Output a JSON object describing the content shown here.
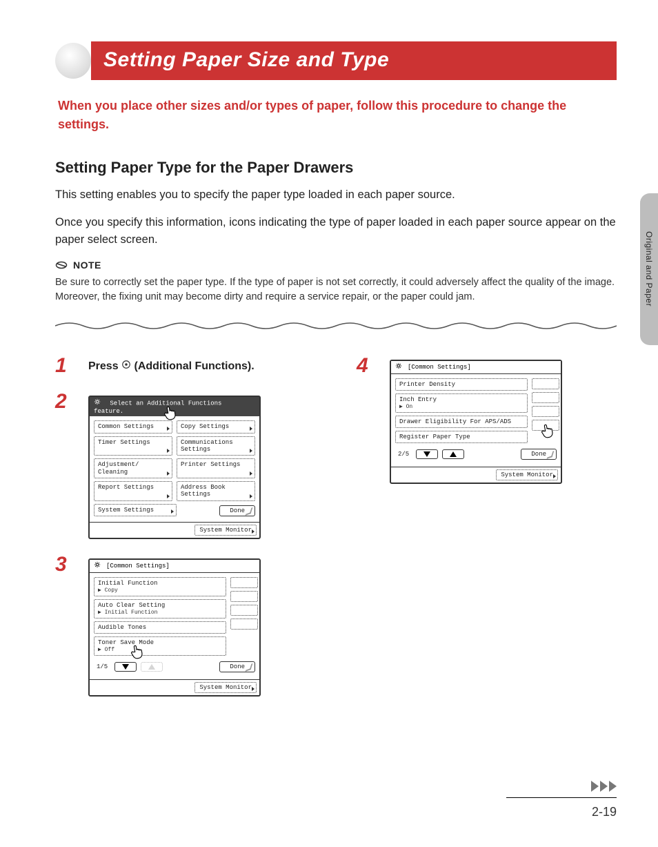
{
  "side_tab": "Original and Paper",
  "title": "Setting Paper Size and Type",
  "intro": "When you place other sizes and/or types of paper, follow this procedure to change the settings.",
  "section_heading": "Setting Paper Type for the Paper Drawers",
  "section_body_1": "This setting enables you to specify the paper type loaded in each paper source.",
  "section_body_2": "Once you specify this information, icons indicating the type of paper loaded in each paper source appear on the paper select screen.",
  "note_label": "NOTE",
  "note_body": "Be sure to correctly set the paper type. If the type of paper is not set correctly, it could adversely affect the quality of the image. Moreover, the fixing unit may become dirty and require a service repair, or the paper could jam.",
  "steps": {
    "s1": {
      "num": "1",
      "label_pre": "Press ",
      "label_post": " (Additional Functions)."
    },
    "s2": {
      "num": "2"
    },
    "s3": {
      "num": "3"
    },
    "s4": {
      "num": "4"
    }
  },
  "screen2": {
    "title": "Select an Additional Functions feature.",
    "buttons": [
      [
        "Common Settings",
        "Copy Settings"
      ],
      [
        "Timer Settings",
        "Communications Settings"
      ],
      [
        "Adjustment/ Cleaning",
        "Printer Settings"
      ],
      [
        "Report Settings",
        "Address Book Settings"
      ],
      [
        "System Settings",
        ""
      ]
    ],
    "done": "Done",
    "sysmon": "System Monitor"
  },
  "screen3": {
    "title": "[Common Settings]",
    "rows": [
      {
        "main": "Initial Function",
        "sub": "▶ Copy"
      },
      {
        "main": "Auto Clear Setting",
        "sub": "▶ Initial Function"
      },
      {
        "main": "Audible Tones",
        "sub": ""
      },
      {
        "main": "Toner Save Mode",
        "sub": "▶ Off"
      }
    ],
    "page": "1/5",
    "done": "Done",
    "sysmon": "System Monitor"
  },
  "screen4": {
    "title": "[Common Settings]",
    "rows": [
      {
        "main": "Printer Density",
        "sub": ""
      },
      {
        "main": "Inch Entry",
        "sub": "▶ On"
      },
      {
        "main": "Drawer Eligibility For APS/ADS",
        "sub": ""
      },
      {
        "main": "Register Paper Type",
        "sub": ""
      }
    ],
    "page": "2/5",
    "done": "Done",
    "sysmon": "System Monitor"
  },
  "footer_page": "2-19"
}
